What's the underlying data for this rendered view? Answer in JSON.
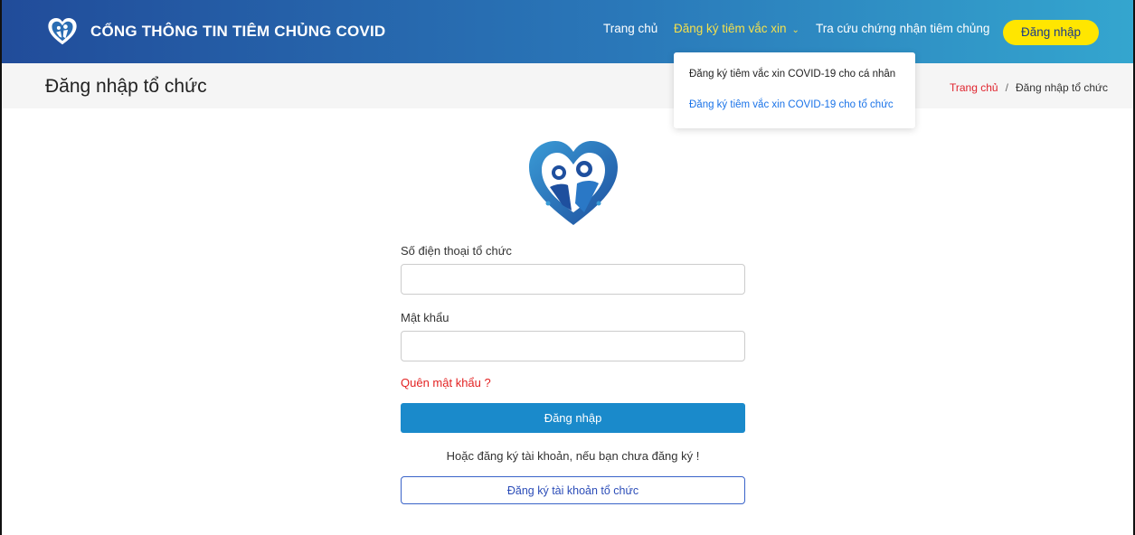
{
  "header": {
    "brand_title": "CỔNG THÔNG TIN TIÊM CHỦNG COVID",
    "nav": {
      "home": "Trang chủ",
      "register_vaccine": "Đăng ký tiêm vắc xin",
      "lookup_certificate": "Tra cứu chứng nhận tiêm chủng"
    },
    "login_button": "Đăng nhập"
  },
  "dropdown": {
    "items": [
      "Đăng ký tiêm vắc xin COVID-19 cho cá nhân",
      "Đăng ký tiêm vắc xin COVID-19 cho tổ chức"
    ]
  },
  "subheader": {
    "page_title": "Đăng nhập tổ chức",
    "breadcrumb": {
      "home": "Trang chủ",
      "separator": "/",
      "current": "Đăng nhập tổ chức"
    }
  },
  "form": {
    "phone_label": "Số điện thoại tổ chức",
    "phone_value": "",
    "password_label": "Mật khẩu",
    "password_value": "",
    "forgot_password": "Quên mật khẩu ?",
    "submit_label": "Đăng nhập",
    "register_hint": "Hoặc đăng ký tài khoản, nếu bạn chưa đăng ký !",
    "register_button": "Đăng ký tài khoản tổ chức"
  },
  "colors": {
    "header_start": "#214c9a",
    "header_end": "#34a6cf",
    "active_nav": "#f4e04d",
    "login_pill": "#ffe600",
    "submit": "#1a8acb",
    "forgot": "#e32222"
  },
  "icons": {
    "brand": "heart-family-logo-icon",
    "nav_dropdown": "chevron-down-icon"
  }
}
